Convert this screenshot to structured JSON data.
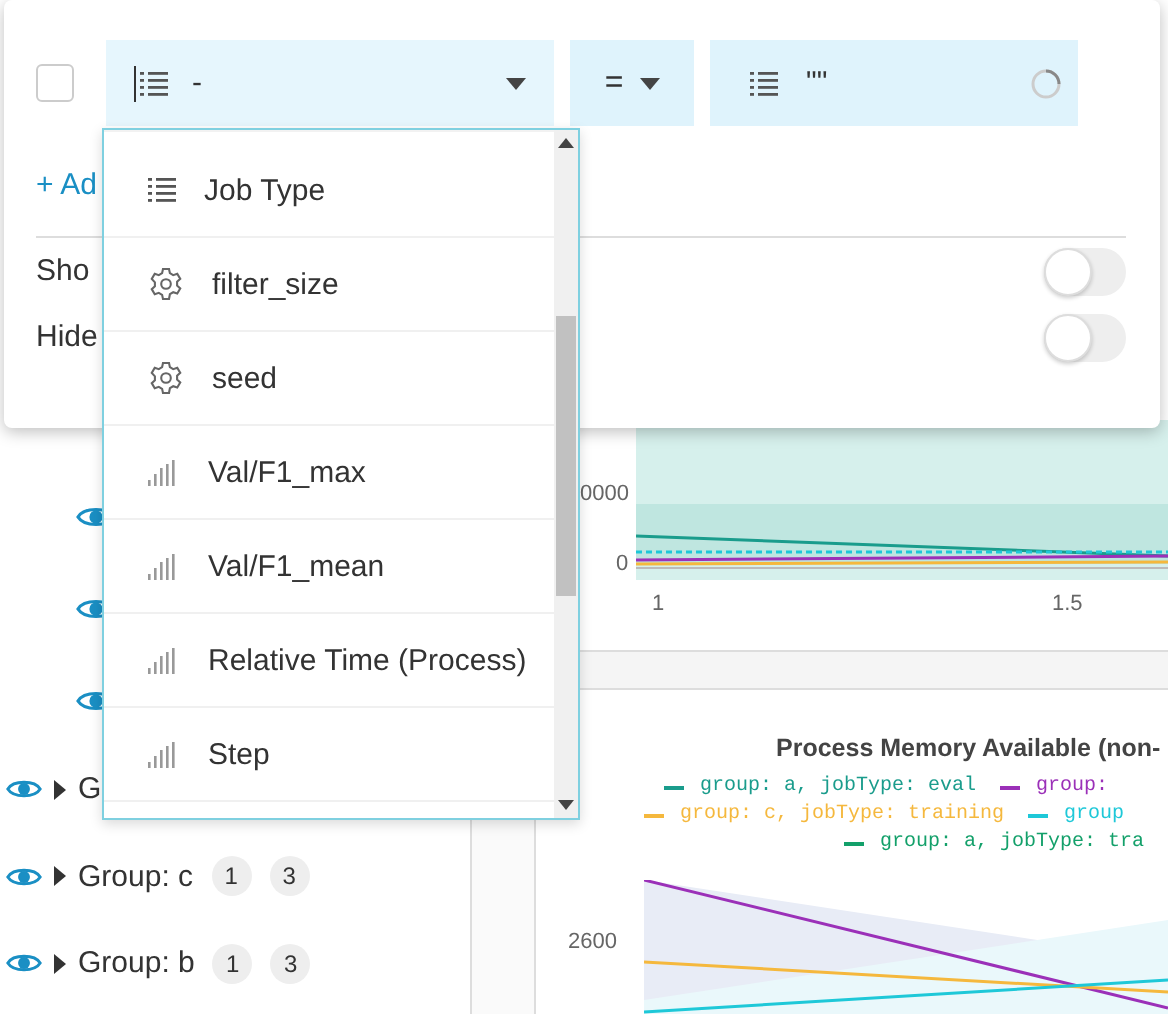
{
  "filter": {
    "checked": false,
    "field": "-",
    "operator": "=",
    "value": "\"\"",
    "loading": true
  },
  "add_filter": "+ Ad",
  "options": [
    {
      "label": "Sho",
      "on": false
    },
    {
      "label": "Hide",
      "on": false
    }
  ],
  "dropdown": {
    "items": [
      {
        "kind": "text",
        "label": "Job Type"
      },
      {
        "kind": "config",
        "label": "filter_size"
      },
      {
        "kind": "config",
        "label": "seed"
      },
      {
        "kind": "metric",
        "label": "Val/F1_max"
      },
      {
        "kind": "metric",
        "label": "Val/F1_mean"
      },
      {
        "kind": "metric",
        "label": "Relative Time (Process)"
      },
      {
        "kind": "metric",
        "label": "Step"
      }
    ]
  },
  "runs": [
    {
      "visible": true
    },
    {
      "visible": true
    },
    {
      "visible": true
    }
  ],
  "groups": [
    {
      "label": "G",
      "visible": true
    },
    {
      "label": "Group: c",
      "visible": true,
      "counts": [
        "1",
        "3"
      ]
    },
    {
      "label": "Group: b",
      "visible": true,
      "counts": [
        "1",
        "3"
      ]
    }
  ],
  "upper_chart": {
    "y_labels": [
      "0000",
      "0"
    ],
    "x_labels": [
      "1",
      "1.5"
    ]
  },
  "lower_chart": {
    "title": "Process Memory Available (non-",
    "legend_rows": [
      [
        {
          "label": "group: a, jobType: eval",
          "color": "#1a9c8c"
        },
        {
          "label": "group:",
          "color": "#9b30b8"
        }
      ],
      [
        {
          "label": "group: c, jobType: training",
          "color": "#f5b83d"
        },
        {
          "label": "group",
          "color": "#1ec8d8"
        }
      ],
      [
        {
          "label": "group: a, jobType: tra",
          "color": "#13a06a"
        }
      ]
    ],
    "y_labels": [
      "2600"
    ]
  }
}
